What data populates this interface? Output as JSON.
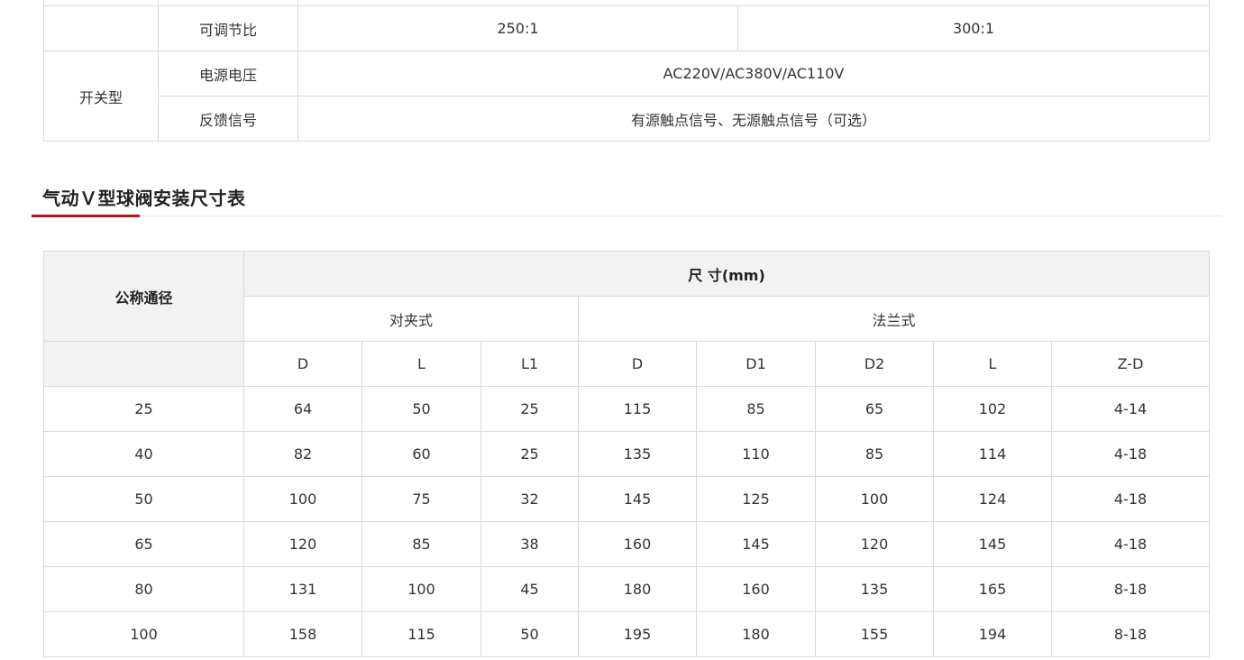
{
  "spec_table": {
    "row_top": {
      "label": "",
      "value": ""
    },
    "row_ratio": {
      "label": "可调节比",
      "value_1": "250:1",
      "value_2": "300:1"
    },
    "switch_group": {
      "title": "开关型",
      "rows": [
        {
          "label": "电源电压",
          "value": "AC220V/AC380V/AC110V"
        },
        {
          "label": "反馈信号",
          "value": "有源触点信号、无源触点信号（可选）"
        }
      ]
    }
  },
  "section": {
    "title": "气动Ｖ型球阀安装尺寸表",
    "accent_color": "#b8121a"
  },
  "dims_table": {
    "header": {
      "nominal": "公称通径",
      "size": "尺 寸(mm)",
      "wafer": "对夹式",
      "flange": "法兰式"
    },
    "columns": [
      "D",
      "L",
      "L1",
      "D",
      "D1",
      "D2",
      "L",
      "Z-D"
    ],
    "rows": [
      [
        "25",
        "64",
        "50",
        "25",
        "115",
        "85",
        "65",
        "102",
        "4-14"
      ],
      [
        "40",
        "82",
        "60",
        "25",
        "135",
        "110",
        "85",
        "114",
        "4-18"
      ],
      [
        "50",
        "100",
        "75",
        "32",
        "145",
        "125",
        "100",
        "124",
        "4-18"
      ],
      [
        "65",
        "120",
        "85",
        "38",
        "160",
        "145",
        "120",
        "145",
        "4-18"
      ],
      [
        "80",
        "131",
        "100",
        "45",
        "180",
        "160",
        "135",
        "165",
        "8-18"
      ],
      [
        "100",
        "158",
        "115",
        "50",
        "195",
        "180",
        "155",
        "194",
        "8-18"
      ]
    ]
  }
}
